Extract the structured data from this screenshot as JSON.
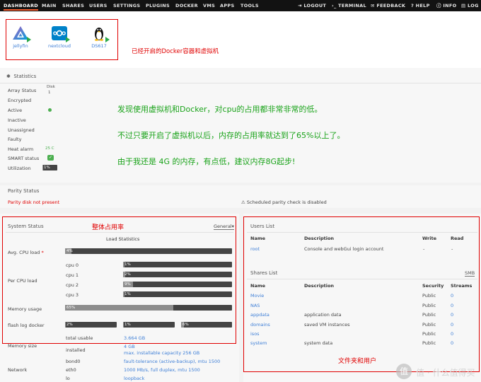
{
  "nav": {
    "tabs": [
      "DASHBOARD",
      "MAIN",
      "SHARES",
      "USERS",
      "SETTINGS",
      "PLUGINS",
      "DOCKER",
      "VMS",
      "APPS",
      "TOOLS"
    ],
    "actions": [
      "LOGOUT",
      "TERMINAL",
      "FEEDBACK",
      "HELP",
      "INFO",
      "LOG"
    ]
  },
  "apps": [
    {
      "name": "jellyfin",
      "icon": "jellyfin-icon"
    },
    {
      "name": "nextcloud",
      "icon": "nextcloud-icon"
    },
    {
      "name": "DS617",
      "icon": "linux-penguin-icon"
    }
  ],
  "annotations": {
    "docker_vm": "已经开启的Docker容器和虚拟机",
    "line1": "发现使用虚拟机和Docker，对cpu的占用都非常非常的低。",
    "line2": "不过只要开启了虚拟机以后，内存的占用率就达到了65%以上了。",
    "line3": "由于我还是 4G 的内存，有点低，建议内存8G起步!",
    "overall": "整体占用率",
    "folders": "文件夹和用户"
  },
  "statistics": {
    "title": "Statistics",
    "disk_header": "Disk",
    "disk_num": "1",
    "rows": [
      {
        "label": "Array Status",
        "value": ""
      },
      {
        "label": "Encrypted",
        "value": ""
      },
      {
        "label": "Active",
        "value": ""
      },
      {
        "label": "Inactive",
        "value": ""
      },
      {
        "label": "Unassigned",
        "value": ""
      },
      {
        "label": "Faulty",
        "value": ""
      },
      {
        "label": "Heat alarm",
        "value": "25 C"
      },
      {
        "label": "SMART status",
        "value": ""
      },
      {
        "label": "Utilization",
        "value": "1%"
      }
    ],
    "utilization": 0.01
  },
  "parity": {
    "title": "Parity Status",
    "status": "Parity disk not present",
    "check": "Scheduled parity check is disabled"
  },
  "system_status": {
    "title": "System Status",
    "dropdown": "General",
    "load_title": "Load Statistics",
    "avg_label": "Avg. CPU load",
    "avg_value": "4%",
    "avg": 0.04,
    "per_cpu_label": "Per CPU load",
    "cpus": [
      {
        "name": "cpu 0",
        "value": "1%",
        "v": 0.01
      },
      {
        "name": "cpu 1",
        "value": "2%",
        "v": 0.02
      },
      {
        "name": "cpu 2",
        "value": "9%",
        "v": 0.09
      },
      {
        "name": "cpu 3",
        "value": "1%",
        "v": 0.01
      }
    ],
    "memory_label": "Memory usage",
    "memory_value": "65%",
    "memory": 0.65,
    "flash_label": "flash log docker",
    "flash": [
      {
        "value": "2%",
        "v": 0.02
      },
      {
        "value": "1%",
        "v": 0.01
      },
      {
        "value": "6%",
        "v": 0.06
      }
    ],
    "total_label": "total usable",
    "total_value": "3.664 GB",
    "memory_size_label": "Memory size",
    "installed_label": "installed",
    "installed_value": "4 GB",
    "max_capacity": "max. installable capacity 256 GB",
    "network_label": "Network",
    "bond0_label": "bond0",
    "bond0_value": "fault-tolerance (active-backup), mtu 1500",
    "eth0_label": "eth0",
    "eth0_value": "1000 Mb/s, full duplex, mtu 1500",
    "lo_label": "lo",
    "lo_value": "loopback"
  },
  "users": {
    "title": "Users List",
    "headers": [
      "Name",
      "Description",
      "Write",
      "Read"
    ],
    "rows": [
      {
        "name": "root",
        "desc": "Console and webGui login account",
        "write": "-",
        "read": "-"
      }
    ]
  },
  "shares": {
    "title": "Shares List",
    "smb": "SMB",
    "headers": [
      "Name",
      "Description",
      "Security",
      "Streams"
    ],
    "rows": [
      {
        "name": "Movie",
        "desc": "",
        "security": "Public",
        "streams": "0"
      },
      {
        "name": "NAS",
        "desc": "",
        "security": "Public",
        "streams": "0"
      },
      {
        "name": "appdata",
        "desc": "application data",
        "security": "Public",
        "streams": "0"
      },
      {
        "name": "domains",
        "desc": "saved VM instances",
        "security": "Public",
        "streams": "0"
      },
      {
        "name": "isos",
        "desc": "",
        "security": "Public",
        "streams": "0"
      },
      {
        "name": "system",
        "desc": "system data",
        "security": "Public",
        "streams": "0"
      }
    ]
  },
  "watermark": "值 · 什么值得买",
  "colors": {
    "accent": "#f15a2c",
    "green": "#1aa31a",
    "red": "#e00000",
    "link": "#3d7ed6"
  }
}
